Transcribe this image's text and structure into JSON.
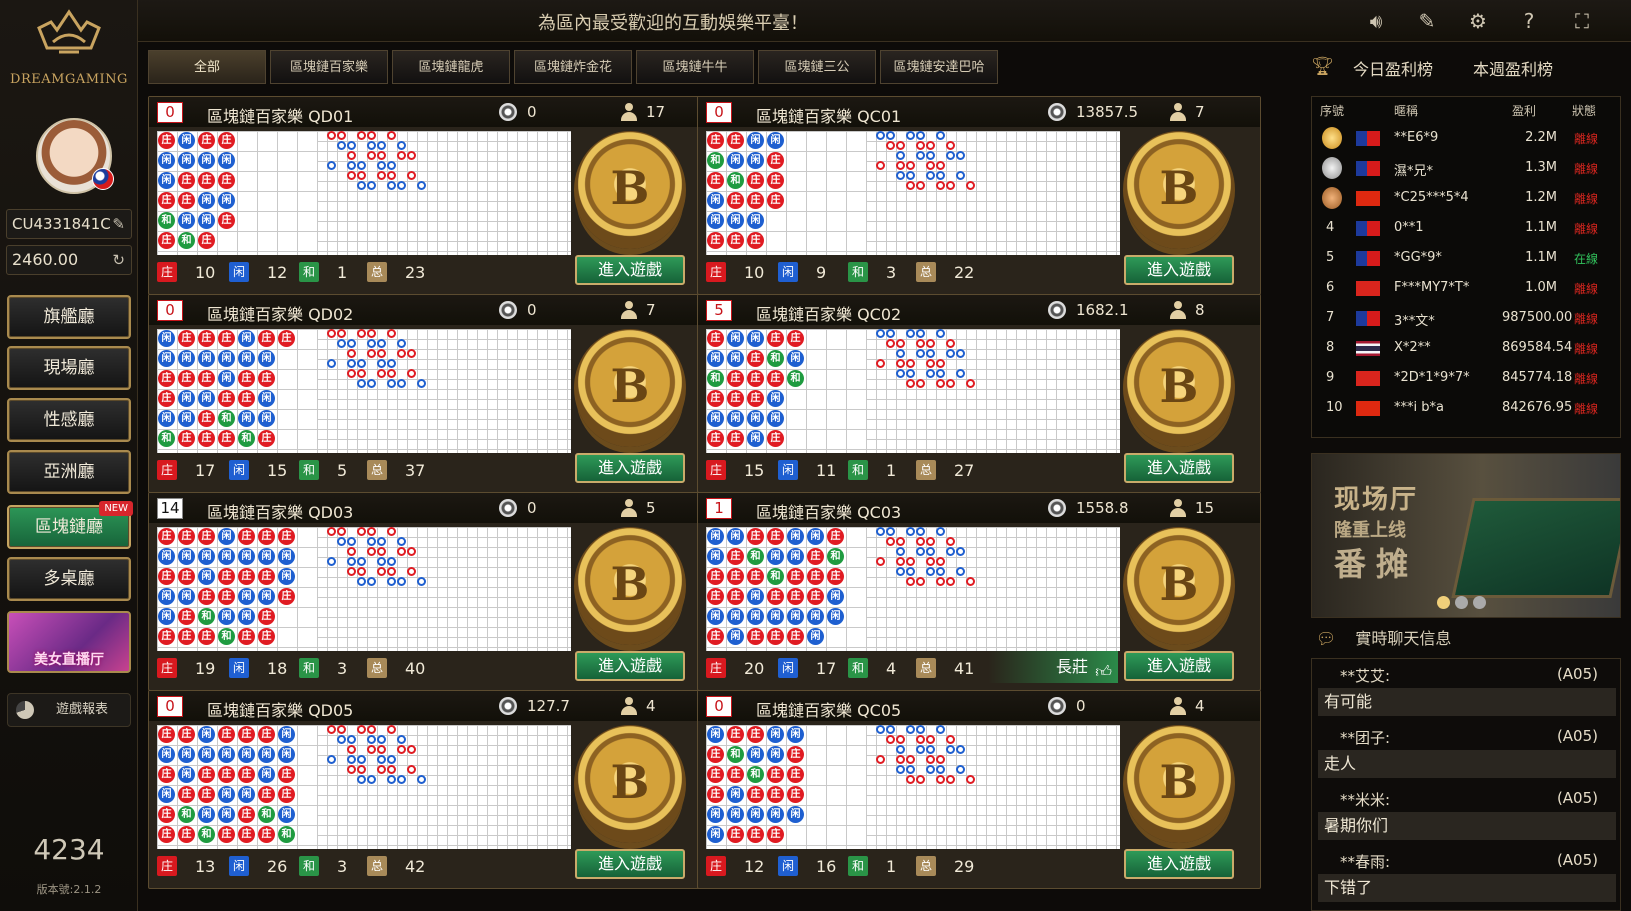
{
  "sidebar": {
    "brand": "DREAMGAMING",
    "user_id": "CU4331841C",
    "balance": "2460.00",
    "halls": [
      {
        "label": "旗艦廳"
      },
      {
        "label": "現場廳"
      },
      {
        "label": "性感廳"
      },
      {
        "label": "亞洲廳"
      },
      {
        "label": "區塊鏈廳",
        "badge": "NEW"
      },
      {
        "label": "多桌廳"
      }
    ],
    "beauty_banner": "美女直播厅",
    "report_label": "遊戲報表",
    "online_count": "4234",
    "version": "版本號:2.1.2"
  },
  "topbar": {
    "announcement": "為區內最受歡迎的互動娛樂平臺！",
    "icons": [
      "speaker-icon",
      "edit-icon",
      "gear-icon",
      "help-icon",
      "fullscreen-icon"
    ]
  },
  "tabs": [
    "全部",
    "區塊鏈百家樂",
    "區塊鏈龍虎",
    "區塊鏈炸金花",
    "區塊鏈牛牛",
    "區塊鏈三公",
    "區塊鏈安達巴哈"
  ],
  "labels": {
    "banker": "庄",
    "player": "闲",
    "tie": "和",
    "total": "总",
    "enter": "進入遊戲"
  },
  "rooms": [
    {
      "count": "0",
      "name": "區塊鏈百家樂 QD01",
      "chip": "0",
      "players": "17",
      "banker": "10",
      "player": "12",
      "tie": "1",
      "total": "23",
      "count_dark": false
    },
    {
      "count": "0",
      "name": "區塊鏈百家樂 QC01",
      "chip": "13857.5",
      "players": "7",
      "banker": "10",
      "player": "9",
      "tie": "3",
      "total": "22",
      "count_dark": false
    },
    {
      "count": "0",
      "name": "區塊鏈百家樂 QD02",
      "chip": "0",
      "players": "7",
      "banker": "17",
      "player": "15",
      "tie": "5",
      "total": "37",
      "count_dark": false
    },
    {
      "count": "5",
      "name": "區塊鏈百家樂 QC02",
      "chip": "1682.1",
      "players": "8",
      "banker": "15",
      "player": "11",
      "tie": "1",
      "total": "27",
      "count_dark": false
    },
    {
      "count": "14",
      "name": "區塊鏈百家樂 QD03",
      "chip": "0",
      "players": "5",
      "banker": "19",
      "player": "18",
      "tie": "3",
      "total": "40",
      "count_dark": true
    },
    {
      "count": "1",
      "name": "區塊鏈百家樂 QC03",
      "chip": "1558.8",
      "players": "15",
      "banker": "20",
      "player": "17",
      "tie": "4",
      "total": "41",
      "count_dark": false,
      "streak": "長莊"
    },
    {
      "count": "0",
      "name": "區塊鏈百家樂 QD05",
      "chip": "127.7",
      "players": "4",
      "banker": "13",
      "player": "26",
      "tie": "3",
      "total": "42",
      "count_dark": false
    },
    {
      "count": "0",
      "name": "區塊鏈百家樂 QC05",
      "chip": "0",
      "players": "4",
      "banker": "12",
      "player": "16",
      "tie": "1",
      "total": "29",
      "count_dark": false
    }
  ],
  "ranking": {
    "tabs": [
      "今日盈利榜",
      "本週盈利榜"
    ],
    "headers": [
      "序號",
      "暱稱",
      "盈利",
      "狀態"
    ],
    "rows": [
      {
        "rank": "",
        "flag": "tw",
        "name": "**E6*9",
        "profit": "2.2M",
        "status": "離線"
      },
      {
        "rank": "",
        "flag": "tw",
        "name": "濕*兄*",
        "profit": "1.3M",
        "status": "離線"
      },
      {
        "rank": "",
        "flag": "cn",
        "name": "*C25***5*4",
        "profit": "1.2M",
        "status": "離線"
      },
      {
        "rank": "4",
        "flag": "tw",
        "name": "0**1",
        "profit": "1.1M",
        "status": "離線"
      },
      {
        "rank": "5",
        "flag": "tw",
        "name": "*GG*9*",
        "profit": "1.1M",
        "status": "在線"
      },
      {
        "rank": "6",
        "flag": "vn",
        "name": "F***MY7*T*",
        "profit": "1.0M",
        "status": "離線"
      },
      {
        "rank": "7",
        "flag": "tw",
        "name": "3**文*",
        "profit": "987500.00",
        "status": "離線"
      },
      {
        "rank": "8",
        "flag": "th",
        "name": "X*2**",
        "profit": "869584.54",
        "status": "離線"
      },
      {
        "rank": "9",
        "flag": "vn",
        "name": "*2D*1*9*7*",
        "profit": "845774.18",
        "status": "離線"
      },
      {
        "rank": "10",
        "flag": "hk",
        "name": "***i b*a",
        "profit": "842676.95",
        "status": "離線"
      }
    ]
  },
  "promo": {
    "title": "现场厅",
    "subtitle": "隆重上线",
    "game": "番摊"
  },
  "chat": {
    "title": "實時聊天信息",
    "messages": [
      {
        "who": "**艾艾:",
        "tag": "(A05)",
        "text": "有可能"
      },
      {
        "who": "**团子:",
        "tag": "(A05)",
        "text": "走人"
      },
      {
        "who": "**米米:",
        "tag": "(A05)",
        "text": "暑期你们"
      },
      {
        "who": "**春雨:",
        "tag": "(A05)",
        "text": "下错了"
      }
    ]
  },
  "colors": {
    "banker": "#e01b22",
    "player": "#1e5fd0",
    "tie": "#1f9b40",
    "accent": "#c9a460",
    "enter_button": "#2e9a58"
  }
}
